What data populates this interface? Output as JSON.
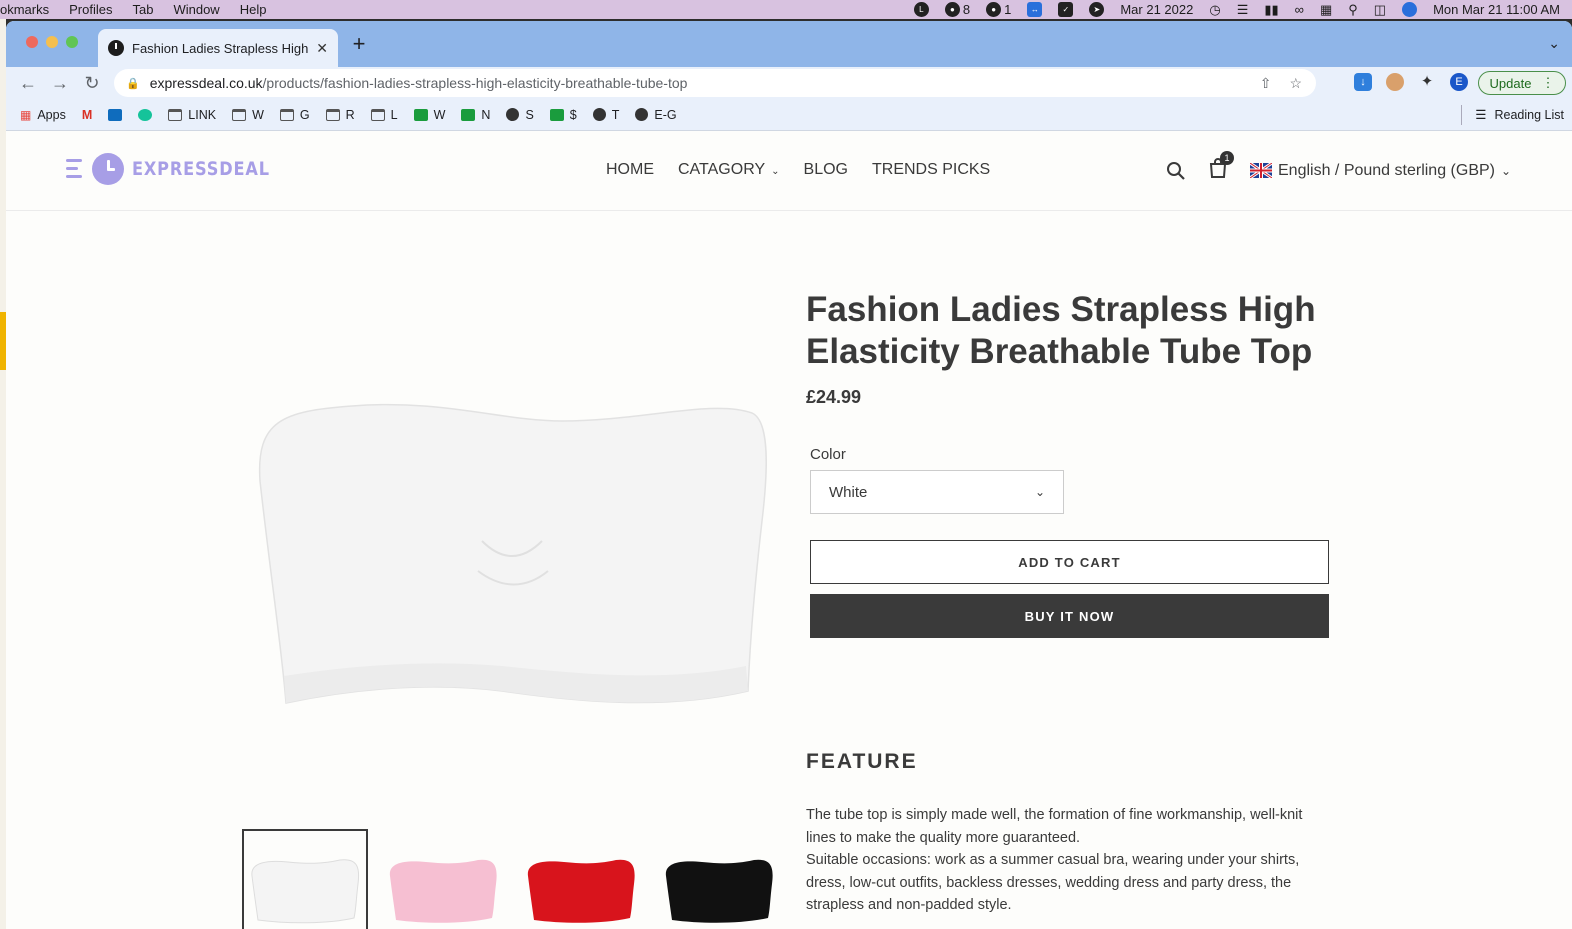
{
  "menubar": {
    "items": [
      "okmarks",
      "Profiles",
      "Tab",
      "Window",
      "Help"
    ],
    "bell_count": "8",
    "wechat_count": "1",
    "date": "Mar 21 2022",
    "clock": "Mon Mar 21  11:00 AM"
  },
  "browser": {
    "tab_title": "Fashion Ladies Strapless High Elasticity Breathable Tube Top",
    "url_host": "expressdeal.co.uk",
    "url_path": "/products/fashion-ladies-strapless-high-elasticity-breathable-tube-top",
    "update_label": "Update",
    "profile_initial": "E",
    "bookmarks": [
      "Apps",
      "LINK",
      "W",
      "G",
      "R",
      "L",
      "W",
      "N",
      "S",
      "$",
      "T",
      "E-G"
    ],
    "reading_list": "Reading List"
  },
  "site": {
    "logo_text": "EXPRESSDEAL",
    "nav": [
      "HOME",
      "CATAGORY",
      "BLOG",
      "TRENDS PICKS"
    ],
    "cart_count": "1",
    "locale": "English / Pound sterling (GBP)"
  },
  "product": {
    "title": "Fashion Ladies Strapless High Elasticity Breathable Tube Top",
    "price": "£24.99",
    "color_label": "Color",
    "color_value": "White",
    "add_to_cart": "ADD TO CART",
    "buy_now": "BUY IT NOW",
    "feature_heading": "FEATURE",
    "feature_line1": "The tube top is simply made well, the formation of fine workmanship, well-knit lines to make the quality more guaranteed.",
    "feature_line2": "Suitable occasions: work as a summer casual bra, wearing under your shirts, dress, low-cut outfits, backless dresses, wedding dress and party dress, the strapless and non-padded style.",
    "thumb_colors": [
      "#f4f4f4",
      "#f6bfd2",
      "#d8141c",
      "#111111"
    ]
  }
}
